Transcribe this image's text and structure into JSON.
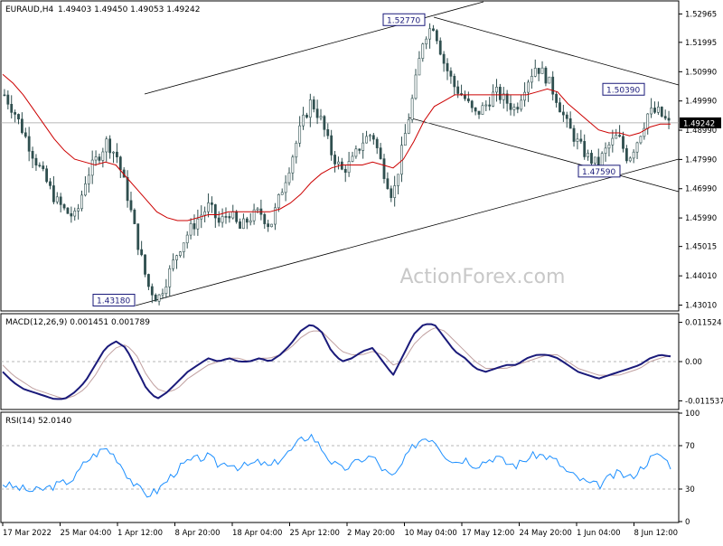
{
  "header": {
    "symbol_timeframe": "EURAUD,H4",
    "ohlc": "1.49403 1.49450 1.49053 1.49242"
  },
  "watermark": "ActionForex.com",
  "colors": {
    "background": "#ffffff",
    "frame": "#000000",
    "candle": "#2f4f4f",
    "sma": "#cc0000",
    "channel": "#000000",
    "price_marker_bg": "#000000",
    "macd_main": "#1a1a7a",
    "macd_signal": "#c0a0a0",
    "rsi": "#1e90ff",
    "level_line": "#a0a0a0",
    "label_border": "#1a1a7a",
    "watermark": "#c8c8c8"
  },
  "chart_data": [
    {
      "type": "candlestick",
      "panel": "price",
      "y_ticks": [
        "1.52965",
        "1.51995",
        "1.50990",
        "1.49990",
        "1.48990",
        "1.47990",
        "1.46990",
        "1.45990",
        "1.45015",
        "1.44010",
        "1.43010"
      ],
      "ylim": [
        1.4284,
        1.5335
      ],
      "current_price_label": "1.49242",
      "current_price": 1.49242,
      "x_ticks": [
        "17 Mar 2022",
        "25 Mar 04:00",
        "1 Apr 12:00",
        "8 Apr 20:00",
        "18 Apr 04:00",
        "25 Apr 12:00",
        "2 May 20:00",
        "10 May 04:00",
        "17 May 12:00",
        "24 May 20:00",
        "1 Jun 04:00",
        "8 Jun 12:00"
      ],
      "annotations": [
        {
          "text": "1.43180",
          "value": 1.4318
        },
        {
          "text": "1.52770",
          "value": 1.5277
        },
        {
          "text": "1.50390",
          "value": 1.5039
        },
        {
          "text": "1.47590",
          "value": 1.4759
        }
      ],
      "price_path": [
        1.502,
        1.496,
        1.488,
        1.48,
        1.473,
        1.466,
        1.462,
        1.46,
        1.474,
        1.48,
        1.486,
        1.481,
        1.468,
        1.452,
        1.437,
        1.432,
        1.44,
        1.449,
        1.455,
        1.46,
        1.464,
        1.458,
        1.462,
        1.456,
        1.46,
        1.462,
        1.457,
        1.468,
        1.479,
        1.491,
        1.5,
        1.493,
        1.482,
        1.476,
        1.479,
        1.486,
        1.489,
        1.477,
        1.467,
        1.485,
        1.502,
        1.522,
        1.526,
        1.513,
        1.505,
        1.501,
        1.495,
        1.498,
        1.503,
        1.5,
        1.497,
        1.506,
        1.512,
        1.508,
        1.501,
        1.492,
        1.486,
        1.481,
        1.478,
        1.484,
        1.488,
        1.48,
        1.487,
        1.496,
        1.496,
        1.492
      ],
      "sma_path": [
        1.509,
        1.506,
        1.502,
        1.497,
        1.492,
        1.487,
        1.483,
        1.48,
        1.479,
        1.478,
        1.479,
        1.478,
        1.474,
        1.47,
        1.466,
        1.462,
        1.46,
        1.459,
        1.459,
        1.46,
        1.461,
        1.461,
        1.462,
        1.462,
        1.462,
        1.462,
        1.462,
        1.463,
        1.465,
        1.468,
        1.472,
        1.475,
        1.477,
        1.478,
        1.478,
        1.478,
        1.479,
        1.478,
        1.477,
        1.48,
        1.486,
        1.493,
        1.498,
        1.5,
        1.502,
        1.502,
        1.502,
        1.502,
        1.502,
        1.502,
        1.502,
        1.502,
        1.503,
        1.504,
        1.503,
        1.499,
        1.496,
        1.493,
        1.49,
        1.489,
        1.489,
        1.488,
        1.489,
        1.491,
        1.492,
        1.492
      ]
    },
    {
      "type": "line",
      "panel": "macd",
      "title": "MACD(12,26,9) 0.001451 0.001789",
      "y_ticks": [
        "0.011524",
        "0.00",
        "-0.011537"
      ],
      "ylim": [
        -0.0138,
        0.0138
      ],
      "series": [
        {
          "values": [
            -0.003,
            -0.006,
            -0.008,
            -0.009,
            -0.01,
            -0.011,
            -0.011,
            -0.009,
            -0.006,
            -0.001,
            0.004,
            0.006,
            0.004,
            -0.002,
            -0.008,
            -0.011,
            -0.009,
            -0.006,
            -0.003,
            -0.001,
            0.001,
            0.0,
            0.001,
            0.0,
            0.0,
            0.001,
            0.0,
            0.002,
            0.005,
            0.009,
            0.011,
            0.009,
            0.003,
            0.0,
            0.001,
            0.003,
            0.004,
            0.0,
            -0.004,
            0.002,
            0.008,
            0.011,
            0.011,
            0.007,
            0.003,
            0.001,
            -0.002,
            -0.003,
            -0.002,
            -0.001,
            -0.001,
            0.001,
            0.002,
            0.002,
            0.001,
            -0.001,
            -0.003,
            -0.004,
            -0.005,
            -0.004,
            -0.003,
            -0.002,
            -0.001,
            0.001,
            0.002,
            0.0015
          ]
        },
        {
          "values": [
            -0.001,
            -0.004,
            -0.006,
            -0.008,
            -0.009,
            -0.01,
            -0.011,
            -0.01,
            -0.008,
            -0.004,
            0.001,
            0.004,
            0.005,
            0.002,
            -0.004,
            -0.008,
            -0.009,
            -0.008,
            -0.005,
            -0.003,
            -0.001,
            0.0,
            0.001,
            0.001,
            0.0,
            0.001,
            0.001,
            0.002,
            0.004,
            0.007,
            0.009,
            0.009,
            0.006,
            0.003,
            0.002,
            0.002,
            0.003,
            0.002,
            -0.001,
            0.0,
            0.005,
            0.008,
            0.01,
            0.009,
            0.006,
            0.003,
            0.0,
            -0.002,
            -0.002,
            -0.002,
            -0.001,
            0.0,
            0.001,
            0.002,
            0.002,
            0.0,
            -0.002,
            -0.003,
            -0.004,
            -0.004,
            -0.004,
            -0.003,
            -0.002,
            0.0,
            0.001,
            0.0018
          ]
        }
      ]
    },
    {
      "type": "line",
      "panel": "rsi",
      "title": "RSI(14) 52.0140",
      "y_ticks": [
        "100",
        "70",
        "30",
        "0"
      ],
      "ylim": [
        0,
        100
      ],
      "levels": [
        70,
        30
      ],
      "series": [
        {
          "values": [
            35,
            32,
            30,
            28,
            30,
            33,
            36,
            40,
            55,
            62,
            68,
            60,
            45,
            32,
            25,
            28,
            38,
            48,
            55,
            58,
            60,
            52,
            55,
            50,
            52,
            55,
            50,
            58,
            65,
            75,
            80,
            68,
            55,
            48,
            52,
            58,
            60,
            48,
            40,
            55,
            70,
            78,
            76,
            62,
            55,
            58,
            52,
            56,
            60,
            54,
            52,
            58,
            62,
            60,
            55,
            45,
            40,
            35,
            33,
            40,
            45,
            40,
            48,
            58,
            62,
            52
          ]
        }
      ]
    }
  ]
}
